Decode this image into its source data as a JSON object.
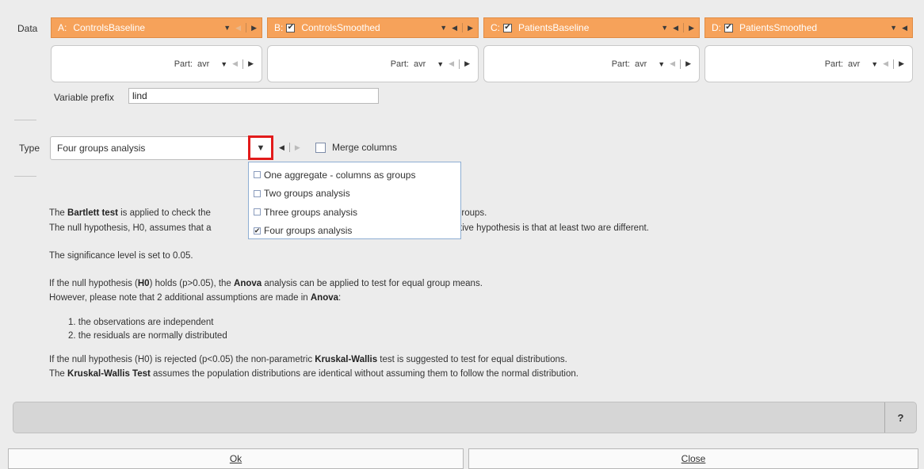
{
  "data_label": "Data",
  "columns": [
    {
      "letter": "A:",
      "checked": false,
      "name": "ControlsBaseline",
      "part_label": "Part:",
      "part_value": "avr"
    },
    {
      "letter": "B:",
      "checked": true,
      "name": "ControlsSmoothed",
      "part_label": "Part:",
      "part_value": "avr"
    },
    {
      "letter": "C:",
      "checked": true,
      "name": "PatientsBaseline",
      "part_label": "Part:",
      "part_value": "avr"
    },
    {
      "letter": "D:",
      "checked": true,
      "name": "PatientsSmoothed",
      "part_label": "Part:",
      "part_value": "avr"
    }
  ],
  "prefix": {
    "label": "Variable prefix",
    "value": "lind"
  },
  "type": {
    "label": "Type",
    "value": "Four groups analysis",
    "merge_label": "Merge columns",
    "merge_checked": false,
    "options": [
      {
        "label": "One aggregate - columns as groups",
        "selected": false
      },
      {
        "label": "Two groups analysis",
        "selected": false
      },
      {
        "label": "Three groups analysis",
        "selected": false
      },
      {
        "label": "Four groups analysis",
        "selected": true
      }
    ]
  },
  "description": {
    "l1a": "The ",
    "l1b": "Bartlett test",
    "l1c": " is applied to check the",
    "l1d": "groups.",
    "l2a": "The null hypothesis, H0, assumes that a",
    "l2b": "tive hypothesis is that at least two are different.",
    "l3": "The significance level is set to 0.05.",
    "l4a": "If the null hypothesis (",
    "l4b": "H0",
    "l4c": ") holds (p>0.05), the ",
    "l4d": "Anova",
    "l4e": " analysis can be applied to test for equal group means.",
    "l5a": "However, please note that 2 additional assumptions are made in ",
    "l5b": "Anova",
    "l5c": ":",
    "item1": "1.  the observations are independent",
    "item2": "2.  the residuals are normally distributed",
    "l6a": "If the null hypothesis (H0) is rejected (p<0.05) the non-parametric ",
    "l6b": "Kruskal-Wallis",
    "l6c": " test is suggested to test for equal distributions.",
    "l7a": "The ",
    "l7b": "Kruskal-Wallis Test",
    "l7c": " assumes the population distributions are identical without assuming them to follow the normal distribution."
  },
  "help_label": "?",
  "buttons": {
    "ok": "Ok",
    "close": "Close"
  },
  "colors": {
    "header": "#f6a25a",
    "highlight": "#e21b1b"
  }
}
